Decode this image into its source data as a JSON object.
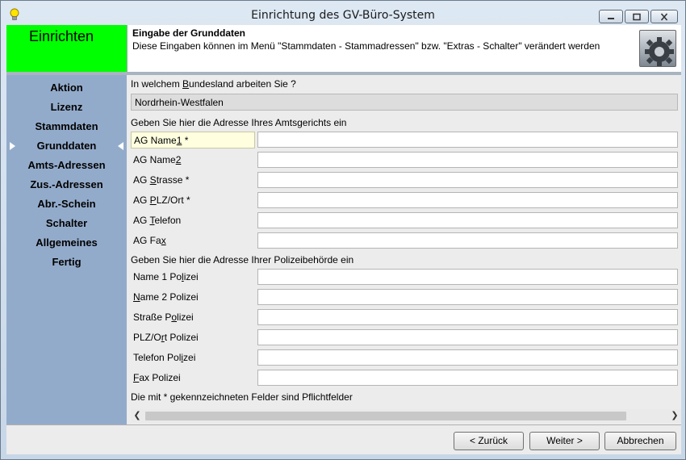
{
  "window": {
    "title": "Einrichtung des GV-Büro-System"
  },
  "header": {
    "section_label": "Einrichten",
    "title": "Eingabe der Grunddaten",
    "description": "Diese Eingaben können im Menü \"Stammdaten - Stammadressen\" bzw. \"Extras - Schalter\" verändert werden"
  },
  "sidebar": {
    "items": [
      {
        "label": "Aktion"
      },
      {
        "label": "Lizenz"
      },
      {
        "label": "Stammdaten"
      },
      {
        "label": "Grunddaten",
        "active": true
      },
      {
        "label": "Amts-Adressen"
      },
      {
        "label": "Zus.-Adressen"
      },
      {
        "label": "Abr.-Schein"
      },
      {
        "label": "Schalter"
      },
      {
        "label": "Allgemeines"
      },
      {
        "label": "Fertig"
      }
    ]
  },
  "form": {
    "state_question": {
      "pre": "In welchem ",
      "u": "B",
      "post": "undesland arbeiten Sie ?"
    },
    "state_value": "Nordrhein-Westfalen",
    "court_heading": "Geben Sie hier die Adresse Ihres Amtsgerichts ein",
    "court_fields": [
      {
        "pre": "AG Name",
        "u": "1",
        "post": " *",
        "value": ""
      },
      {
        "pre": "AG Name",
        "u": "2",
        "post": "",
        "value": ""
      },
      {
        "pre": "AG ",
        "u": "S",
        "post": "trasse *",
        "value": ""
      },
      {
        "pre": "AG ",
        "u": "P",
        "post": "LZ/Ort *",
        "value": ""
      },
      {
        "pre": "AG ",
        "u": "T",
        "post": "elefon",
        "value": ""
      },
      {
        "pre": "AG Fa",
        "u": "x",
        "post": "",
        "value": ""
      }
    ],
    "police_heading": "Geben Sie hier die Adresse Ihrer Polizeibehörde ein",
    "police_fields": [
      {
        "pre": "Name 1 Po",
        "u": "l",
        "post": "izei",
        "value": ""
      },
      {
        "pre": "",
        "u": "N",
        "post": "ame 2 Polizei",
        "value": ""
      },
      {
        "pre": "Straße P",
        "u": "o",
        "post": "lizei",
        "value": ""
      },
      {
        "pre": "PLZ/O",
        "u": "r",
        "post": "t Polizei",
        "value": ""
      },
      {
        "pre": "Telefon Pol",
        "u": "i",
        "post": "zei",
        "value": ""
      },
      {
        "pre": "",
        "u": "F",
        "post": "ax Polizei",
        "value": ""
      }
    ],
    "required_note": "Die mit * gekennzeichneten Felder sind Pflichtfelder"
  },
  "footer": {
    "back_label": "< Zurück",
    "next_label": "Weiter >",
    "cancel_label": "Abbrechen"
  },
  "colors": {
    "header_green": "#00ff00",
    "sidebar_bg": "#93abcb"
  },
  "icons": [
    "lightbulb-icon",
    "minimize-icon",
    "maximize-icon",
    "close-icon",
    "gear-icon",
    "chevron-left-icon",
    "chevron-right-icon"
  ]
}
